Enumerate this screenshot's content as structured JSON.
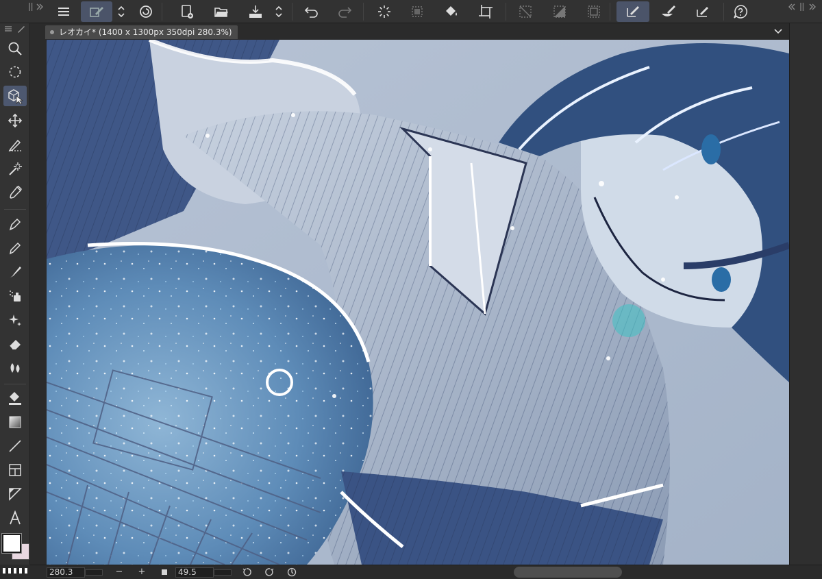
{
  "app": {
    "document_tab_title": "レオカイ* (1400 x 1300px 350dpi 280.3%)"
  },
  "topbar": {
    "buttons": [
      {
        "name": "menu-icon",
        "label": ""
      },
      {
        "name": "edit-icon",
        "label": ""
      },
      {
        "name": "expand-collapse-icon",
        "label": ""
      },
      {
        "name": "swirl-icon",
        "label": ""
      },
      {
        "name": "new-file-icon",
        "label": ""
      },
      {
        "name": "open-folder-icon",
        "label": ""
      },
      {
        "name": "save-tray-icon",
        "label": ""
      },
      {
        "name": "stepper-icon",
        "label": ""
      },
      {
        "name": "undo-icon",
        "label": ""
      },
      {
        "name": "redo-icon",
        "label": ""
      },
      {
        "name": "loading-spinner-icon",
        "label": ""
      },
      {
        "name": "selection-grid-icon",
        "label": ""
      },
      {
        "name": "fill-bucket-icon",
        "label": ""
      },
      {
        "name": "crop-icon",
        "label": ""
      },
      {
        "name": "deselect-icon",
        "label": ""
      },
      {
        "name": "invert-selection-icon",
        "label": ""
      },
      {
        "name": "selection-border-icon",
        "label": ""
      },
      {
        "name": "pen-select-icon",
        "label": ""
      },
      {
        "name": "brush-select-icon",
        "label": ""
      },
      {
        "name": "eraser-select-icon",
        "label": ""
      },
      {
        "name": "help-icon",
        "label": ""
      }
    ]
  },
  "tools": [
    {
      "name": "zoom-icon"
    },
    {
      "name": "lasso-icon"
    },
    {
      "name": "object-select-icon"
    },
    {
      "name": "move-icon"
    },
    {
      "name": "selection-pen-icon"
    },
    {
      "name": "magic-wand-icon"
    },
    {
      "name": "eyedropper-icon"
    },
    {
      "name": "pen-icon"
    },
    {
      "name": "pencil-icon"
    },
    {
      "name": "brush-icon"
    },
    {
      "name": "airbrush-icon"
    },
    {
      "name": "sparkle-icon"
    },
    {
      "name": "eraser-icon"
    },
    {
      "name": "blend-icon"
    },
    {
      "name": "fill-icon"
    },
    {
      "name": "gradient-icon"
    },
    {
      "name": "line-icon"
    },
    {
      "name": "frame-icon"
    },
    {
      "name": "ruler-icon"
    },
    {
      "name": "text-icon"
    }
  ],
  "colors": {
    "main_color": "#ffffff",
    "sub_color": "#e9d8e1",
    "active_tool_bg": "#4d5870"
  },
  "statusbar": {
    "zoom_value": "280.3",
    "zoom_out_label": "−",
    "zoom_in_label": "+",
    "angle_value": "49.5"
  }
}
